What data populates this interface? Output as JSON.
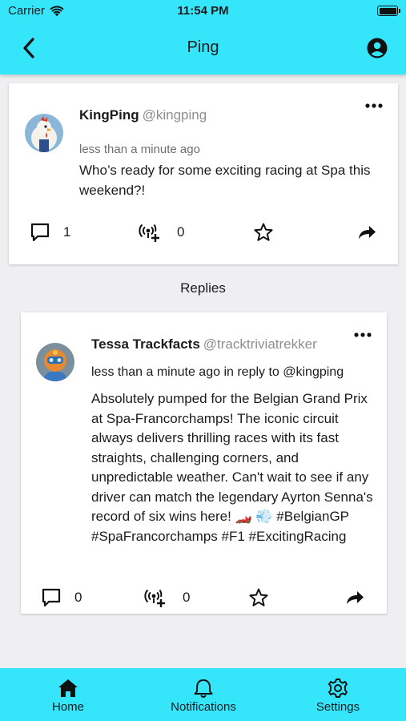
{
  "status_bar": {
    "carrier": "Carrier",
    "time": "11:54 PM"
  },
  "header": {
    "title": "Ping"
  },
  "original_ping": {
    "display_name": "KingPing",
    "handle": "@kingping",
    "timestamp": "less than a minute ago",
    "text": "Who’s ready for some exciting racing at Spa this weekend?!",
    "reply_count": "1",
    "reping_count": "0"
  },
  "replies_label": "Replies",
  "reply": {
    "display_name": "Tessa Trackfacts",
    "handle": "@tracktriviatrekker",
    "timestamp": "less than a minute ago in reply to @kingping",
    "text": "Absolutely pumped for the Belgian Grand Prix at Spa-Francorchamps! The iconic circuit always delivers thrilling races with its fast straights, challenging corners, and unpredictable weather. Can't wait to see if any driver can match the legendary Ayrton Senna's record of six wins here! 🏎️ 💨 #BelgianGP #SpaFrancorchamps #F1 #ExcitingRacing",
    "reply_count": "0",
    "reping_count": "0"
  },
  "tabs": [
    {
      "label": "Home",
      "icon": "home-icon"
    },
    {
      "label": "Notifications",
      "icon": "bell-icon"
    },
    {
      "label": "Settings",
      "icon": "gear-icon"
    }
  ],
  "colors": {
    "accent": "#35e6fb",
    "background": "#efeff1",
    "card": "#ffffff"
  }
}
